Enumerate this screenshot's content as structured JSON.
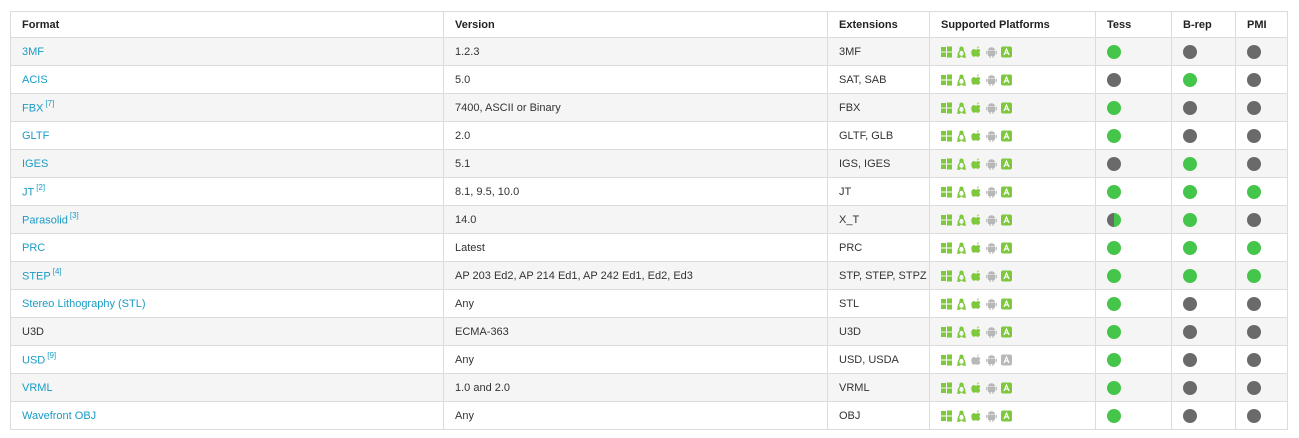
{
  "colors": {
    "supported": "#45c64a",
    "unsupported": "#6a6a6a",
    "platform_on": "#7dc83c",
    "platform_off": "#b8b8b8",
    "link": "#1a9bc6"
  },
  "columns": [
    "Format",
    "Version",
    "Extensions",
    "Supported Platforms",
    "Tess",
    "B-rep",
    "PMI"
  ],
  "platform_icons": [
    "windows-icon",
    "linux-icon",
    "apple-icon",
    "android-icon",
    "ios-icon"
  ],
  "rows": [
    {
      "format": "3MF",
      "ref": "",
      "link": true,
      "version": "1.2.3",
      "extensions": "3MF",
      "platforms": [
        1,
        1,
        1,
        0,
        1
      ],
      "tess": "yes",
      "brep": "no",
      "pmi": "no"
    },
    {
      "format": "ACIS",
      "ref": "",
      "link": true,
      "version": "5.0",
      "extensions": "SAT, SAB",
      "platforms": [
        1,
        1,
        1,
        0,
        1
      ],
      "tess": "no",
      "brep": "yes",
      "pmi": "no"
    },
    {
      "format": "FBX",
      "ref": "[7]",
      "link": true,
      "version": "7400, ASCII or Binary",
      "extensions": "FBX",
      "platforms": [
        1,
        1,
        1,
        0,
        1
      ],
      "tess": "yes",
      "brep": "no",
      "pmi": "no"
    },
    {
      "format": "GLTF",
      "ref": "",
      "link": true,
      "version": "2.0",
      "extensions": "GLTF, GLB",
      "platforms": [
        1,
        1,
        1,
        0,
        1
      ],
      "tess": "yes",
      "brep": "no",
      "pmi": "no"
    },
    {
      "format": "IGES",
      "ref": "",
      "link": true,
      "version": "5.1",
      "extensions": "IGS, IGES",
      "platforms": [
        1,
        1,
        1,
        0,
        1
      ],
      "tess": "no",
      "brep": "yes",
      "pmi": "no"
    },
    {
      "format": "JT",
      "ref": "[2]",
      "link": true,
      "version": "8.1, 9.5, 10.0",
      "extensions": "JT",
      "platforms": [
        1,
        1,
        1,
        0,
        1
      ],
      "tess": "yes",
      "brep": "yes",
      "pmi": "yes"
    },
    {
      "format": "Parasolid",
      "ref": "[3]",
      "link": true,
      "version": "14.0",
      "extensions": "X_T",
      "platforms": [
        1,
        1,
        1,
        0,
        1
      ],
      "tess": "partial",
      "brep": "yes",
      "pmi": "no"
    },
    {
      "format": "PRC",
      "ref": "",
      "link": true,
      "version": "Latest",
      "extensions": "PRC",
      "platforms": [
        1,
        1,
        1,
        0,
        1
      ],
      "tess": "yes",
      "brep": "yes",
      "pmi": "yes"
    },
    {
      "format": "STEP",
      "ref": "[4]",
      "link": true,
      "version": "AP 203 Ed2, AP 214 Ed1, AP 242 Ed1, Ed2, Ed3",
      "extensions": "STP, STEP, STPZ",
      "platforms": [
        1,
        1,
        1,
        0,
        1
      ],
      "tess": "yes",
      "brep": "yes",
      "pmi": "yes"
    },
    {
      "format": "Stereo Lithography (STL)",
      "ref": "",
      "link": true,
      "version": "Any",
      "extensions": "STL",
      "platforms": [
        1,
        1,
        1,
        0,
        1
      ],
      "tess": "yes",
      "brep": "no",
      "pmi": "no"
    },
    {
      "format": "U3D",
      "ref": "",
      "link": false,
      "version": "ECMA-363",
      "extensions": "U3D",
      "platforms": [
        1,
        1,
        1,
        0,
        1
      ],
      "tess": "yes",
      "brep": "no",
      "pmi": "no"
    },
    {
      "format": "USD",
      "ref": "[9]",
      "link": true,
      "version": "Any",
      "extensions": "USD, USDA",
      "platforms": [
        1,
        1,
        0,
        0,
        0
      ],
      "tess": "yes",
      "brep": "no",
      "pmi": "no"
    },
    {
      "format": "VRML",
      "ref": "",
      "link": true,
      "version": "1.0 and 2.0",
      "extensions": "VRML",
      "platforms": [
        1,
        1,
        1,
        0,
        1
      ],
      "tess": "yes",
      "brep": "no",
      "pmi": "no"
    },
    {
      "format": "Wavefront OBJ",
      "ref": "",
      "link": true,
      "version": "Any",
      "extensions": "OBJ",
      "platforms": [
        1,
        1,
        1,
        0,
        1
      ],
      "tess": "yes",
      "brep": "no",
      "pmi": "no"
    }
  ]
}
